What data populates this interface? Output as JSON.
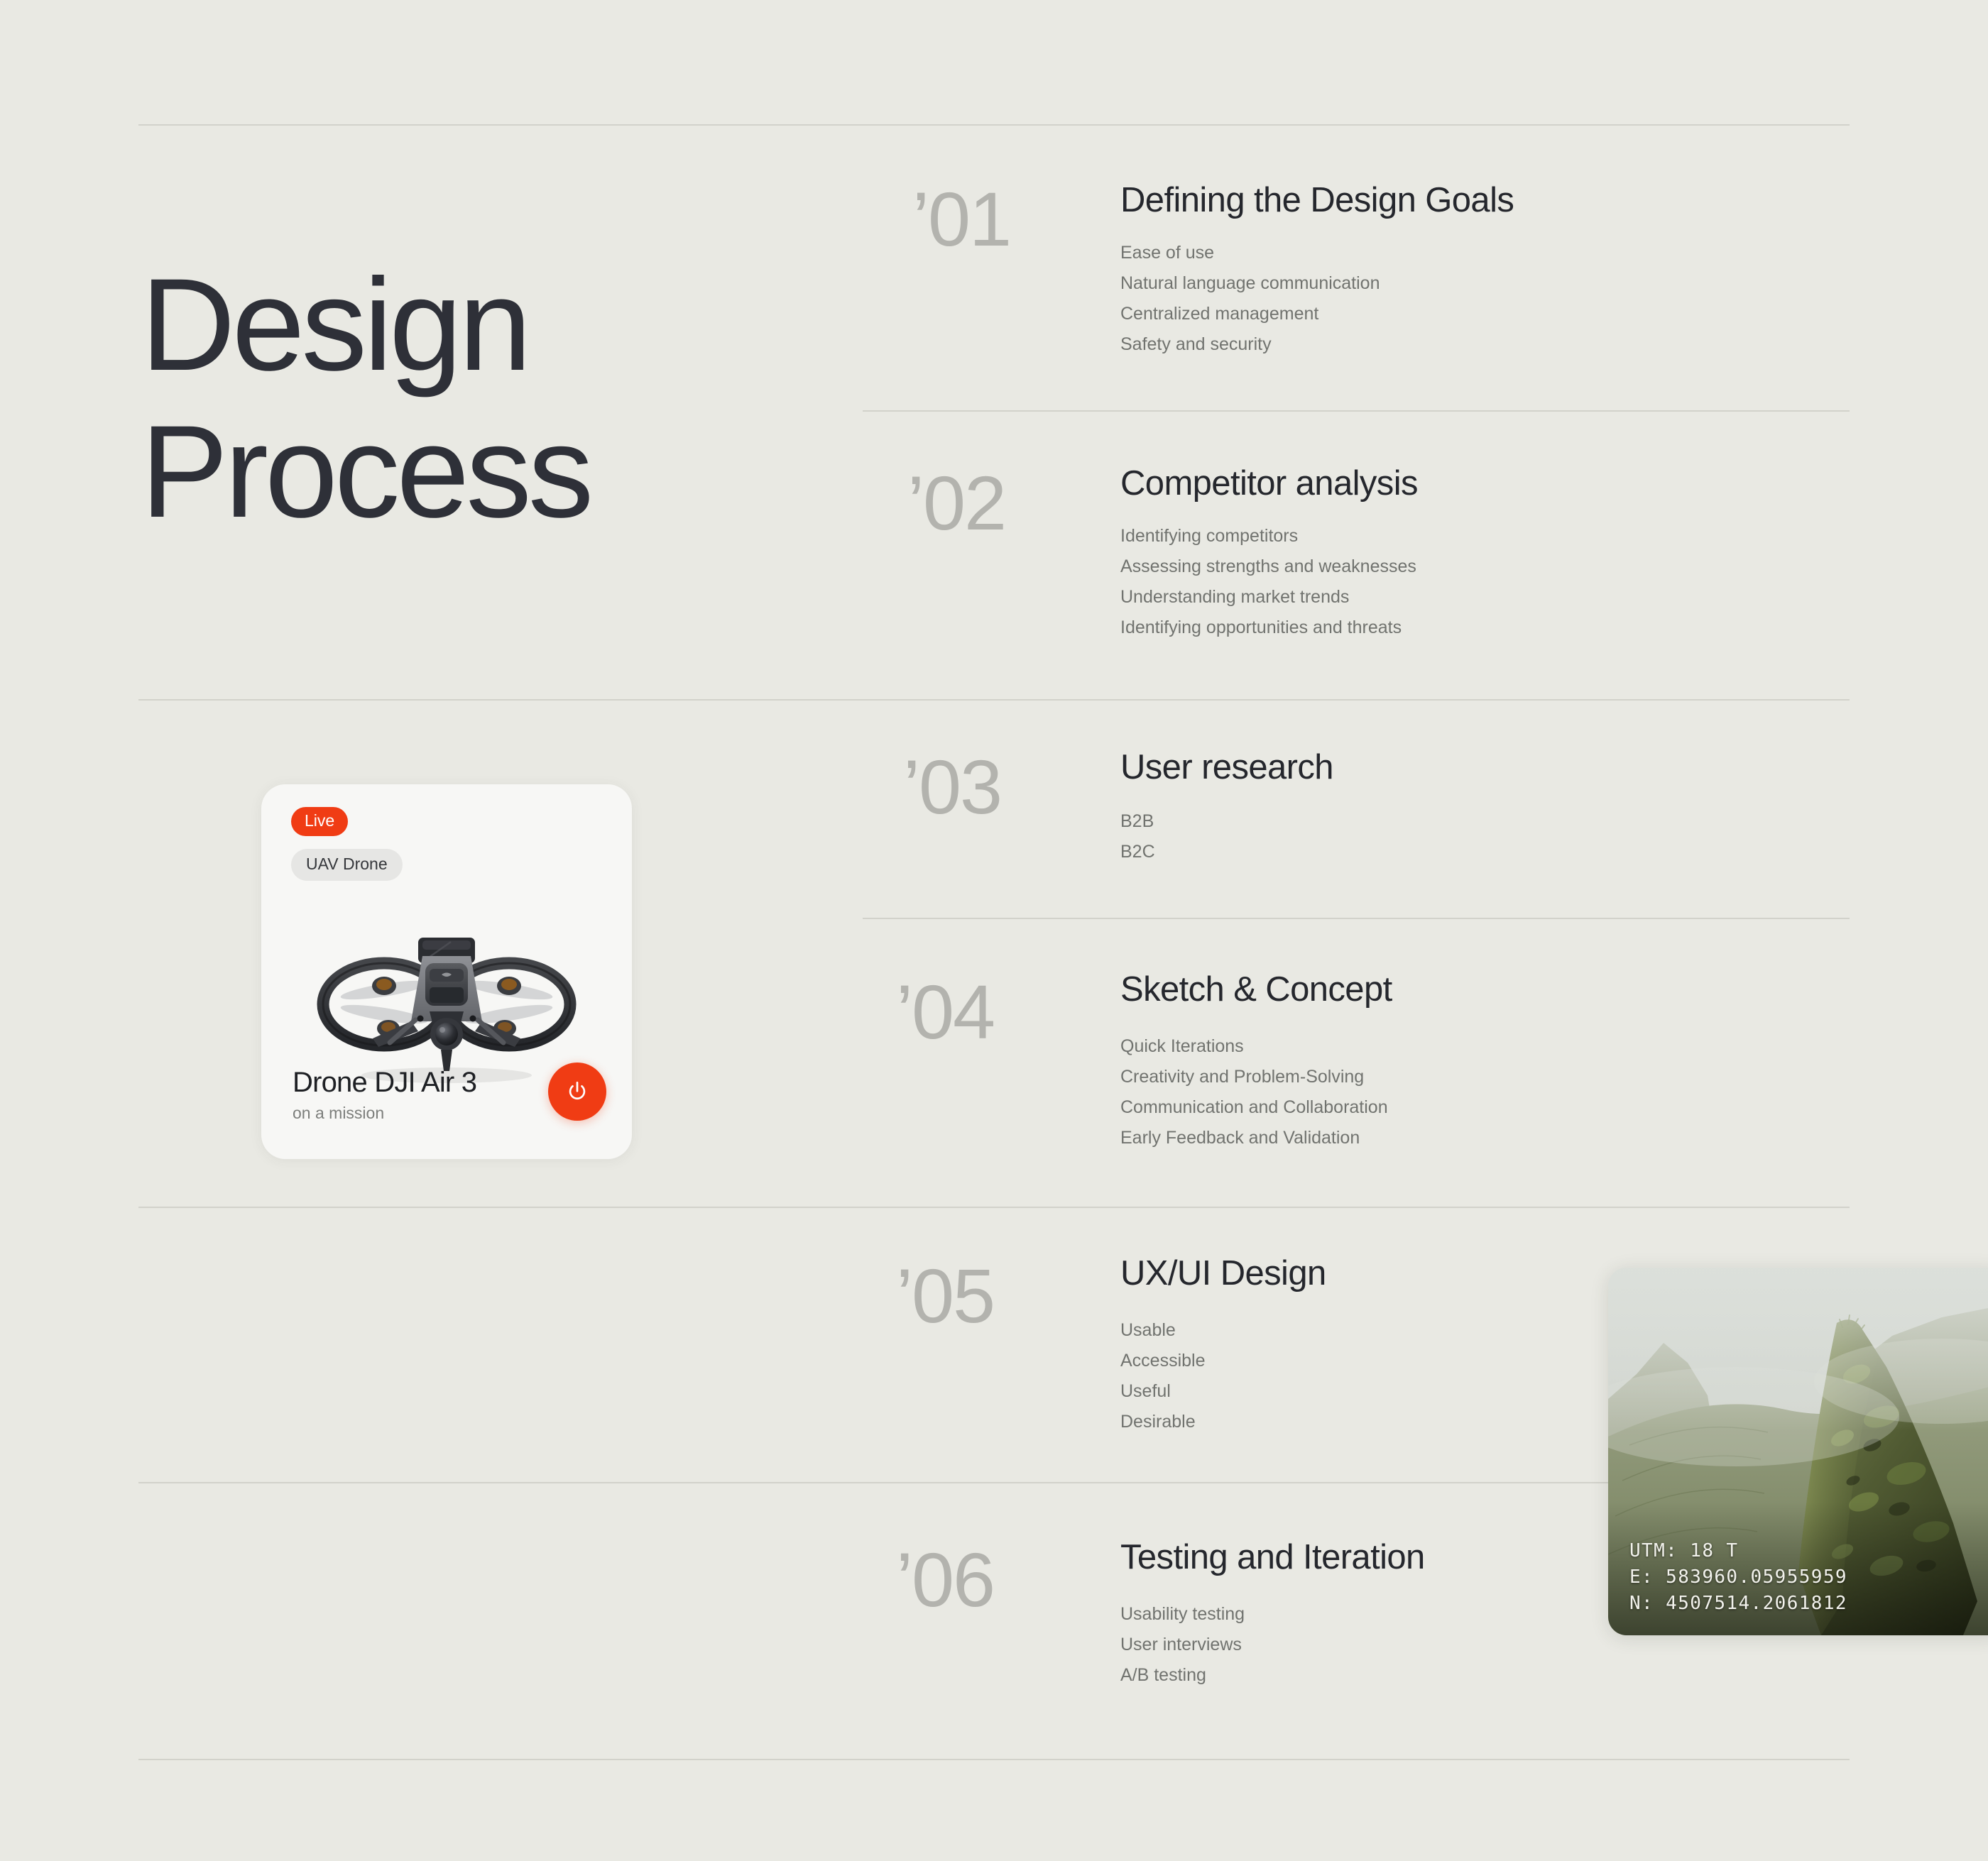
{
  "background_color": "#E9E9E3",
  "accent_color": "#F03C14",
  "heading": {
    "line1": "Design",
    "line2": "Process"
  },
  "process": [
    {
      "number": "’01",
      "title": "Defining the Design Goals",
      "items": [
        "Ease of use",
        "Natural language communication",
        "Centralized management",
        "Safety and security"
      ]
    },
    {
      "number": "’02",
      "title": "Competitor analysis",
      "items": [
        "Identifying competitors",
        "Assessing strengths and weaknesses",
        "Understanding market trends",
        "Identifying opportunities and threats"
      ]
    },
    {
      "number": "’03",
      "title": "User research",
      "items": [
        "B2B",
        "B2C"
      ]
    },
    {
      "number": "’04",
      "title": "Sketch & Concept",
      "items": [
        "Quick Iterations",
        "Creativity and Problem-Solving",
        "Communication and Collaboration",
        "Early Feedback and Validation"
      ]
    },
    {
      "number": "’05",
      "title": "UX/UI Design",
      "items": [
        "Usable",
        "Accessible",
        "Useful",
        "Desirable"
      ]
    },
    {
      "number": "’06",
      "title": "Testing and Iteration",
      "items": [
        "Usability testing",
        "User interviews",
        "A/B testing"
      ]
    }
  ],
  "drone_card": {
    "live_badge": "Live",
    "type_badge": "UAV Drone",
    "name": "Drone DJI Air 3",
    "status": "on a mission",
    "power_icon": "power-icon",
    "image_alt": "uav-drone-illustration"
  },
  "photo_card": {
    "image_alt": "misty-green-mountain-ridge",
    "utm_zone": "UTM: 18 T",
    "easting": "E: 583960.05955959",
    "northing": "N: 4507514.2061812"
  }
}
